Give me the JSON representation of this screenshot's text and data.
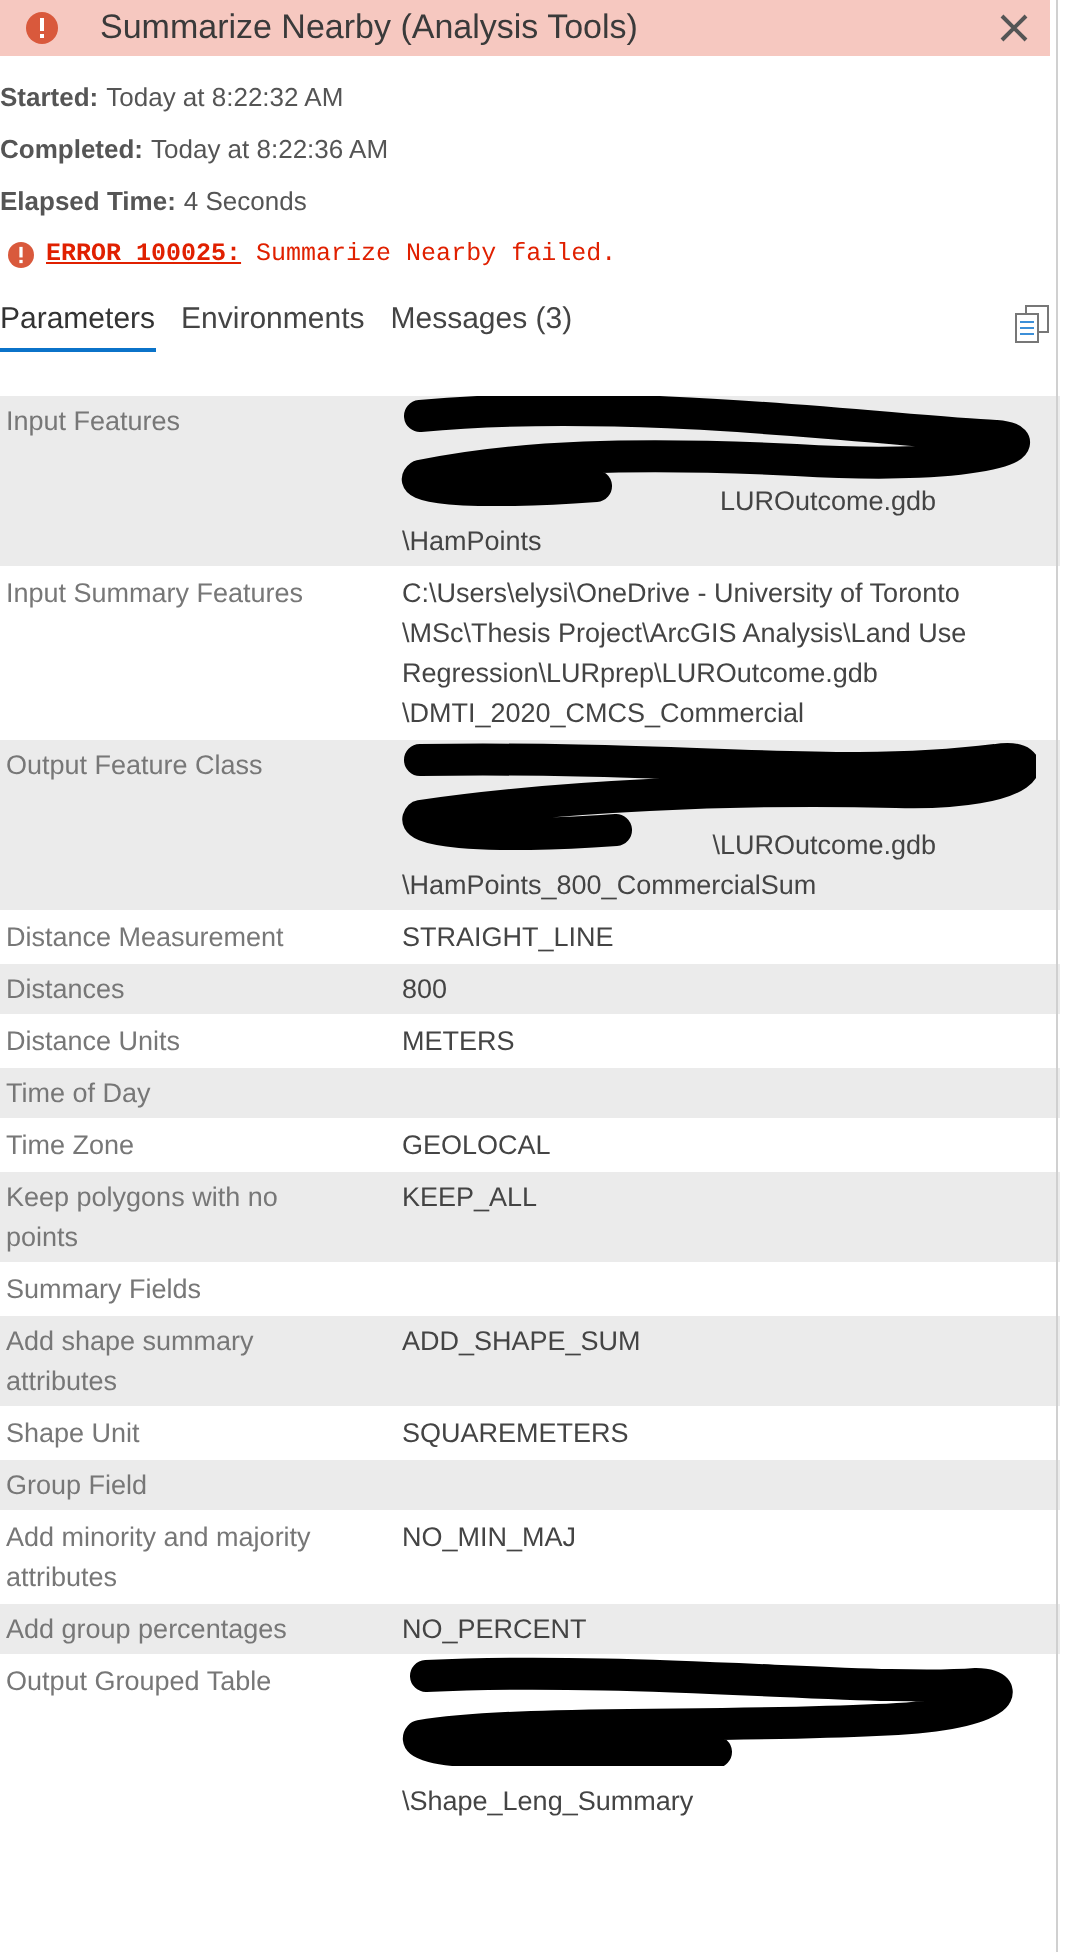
{
  "title_bar": {
    "title": "Summarize Nearby (Analysis Tools)",
    "failed": true
  },
  "info": [
    {
      "label": "Started:",
      "value": "Today at 8:22:32 AM"
    },
    {
      "label": "Completed:",
      "value": "Today at 8:22:36 AM"
    },
    {
      "label": "Elapsed Time:",
      "value": "4 Seconds"
    }
  ],
  "error": {
    "code": "ERROR 100025:",
    "message": "Summarize Nearby failed."
  },
  "tabs": [
    {
      "label": "Parameters",
      "selected": true
    },
    {
      "label": "Environments",
      "selected": false
    },
    {
      "label": "Messages (3)",
      "selected": false
    }
  ],
  "parameters": [
    {
      "name": "Input Features",
      "redacted": true,
      "lines": [
        "LUROutcome.gdb",
        "\\HamPoints"
      ]
    },
    {
      "name": "Input Summary Features",
      "redacted": false,
      "lines": [
        "C:\\Users\\elysi\\OneDrive - University of Toronto",
        "\\MSc\\Thesis Project\\ArcGIS Analysis\\Land Use",
        "Regression\\LURprep\\LUROutcome.gdb",
        "\\DMTI_2020_CMCS_Commercial"
      ]
    },
    {
      "name": "Output Feature Class",
      "redacted": true,
      "lines": [
        "\\LUROutcome.gdb",
        "\\HamPoints_800_CommercialSum"
      ]
    },
    {
      "name": "Distance Measurement",
      "redacted": false,
      "lines": [
        "STRAIGHT_LINE"
      ]
    },
    {
      "name": "Distances",
      "redacted": false,
      "lines": [
        "800"
      ]
    },
    {
      "name": "Distance Units",
      "redacted": false,
      "lines": [
        "METERS"
      ]
    },
    {
      "name": "Time of Day",
      "redacted": false
    },
    {
      "name": "Time Zone",
      "redacted": false,
      "lines": [
        "GEOLOCAL"
      ]
    },
    {
      "name": "Keep polygons with no points",
      "redacted": false,
      "lines": [
        "KEEP_ALL"
      ]
    },
    {
      "name": "Summary Fields",
      "redacted": false
    },
    {
      "name": "Add shape summary attributes",
      "redacted": false,
      "lines": [
        "ADD_SHAPE_SUM"
      ]
    },
    {
      "name": "Shape Unit",
      "redacted": false,
      "lines": [
        "SQUAREMETERS"
      ]
    },
    {
      "name": "Group Field",
      "redacted": false
    },
    {
      "name": "Add minority and majority attributes",
      "redacted": false,
      "lines": [
        "NO_MIN_MAJ"
      ]
    },
    {
      "name": "Add group percentages",
      "redacted": false,
      "lines": [
        "NO_PERCENT"
      ]
    },
    {
      "name": "Output Grouped Table",
      "redacted": true,
      "lines": [
        "\\Shape_Leng_Summary"
      ]
    }
  ]
}
